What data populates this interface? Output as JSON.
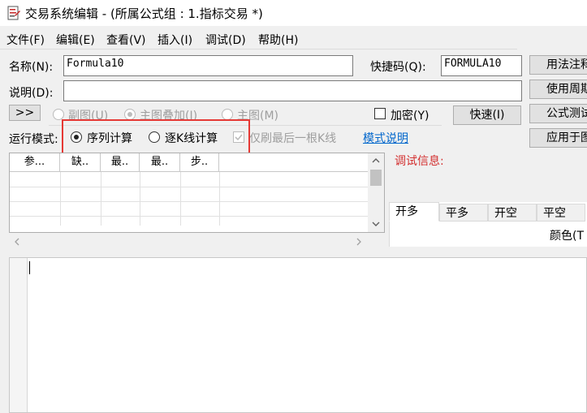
{
  "window": {
    "title": "交易系统编辑 - (所属公式组 : 1.指标交易 *)",
    "highlight_color": "#e53935"
  },
  "menu": {
    "items": [
      "文件(F)",
      "编辑(E)",
      "查看(V)",
      "插入(I)",
      "调试(D)",
      "帮助(H)"
    ]
  },
  "form": {
    "name_label": "名称(N):",
    "name_value": "Formula10",
    "shortcut_label": "快捷码(Q):",
    "shortcut_value": "FORMULA10",
    "desc_label": "说明(D):",
    "desc_value": ""
  },
  "right_buttons": [
    "用法注释",
    "使用周期",
    "公式测试",
    "应用于图"
  ],
  "options_row": {
    "expand_label": ">>",
    "sub_chart": "副图(U)",
    "main_overlay": "主图叠加(I)",
    "main_chart": "主图(M)",
    "encrypt": "加密(Y)",
    "quick_button": "快速(I)"
  },
  "mode_row": {
    "label": "运行模式:",
    "sequence": "序列计算",
    "bar_by_bar": "逐K线计算",
    "last_bar_only": "仅刷最后一根K线",
    "mode_help": "模式说明",
    "selected": "序列计算"
  },
  "params_table": {
    "columns": [
      "参...",
      "缺..",
      "最..",
      "最..",
      "步.."
    ]
  },
  "debug": {
    "label": "调试信息:",
    "label_color": "#d32f2f"
  },
  "trade_tabs": {
    "tabs": [
      "开多",
      "平多",
      "开空",
      "平空"
    ],
    "active": "开多",
    "color_label": "颜色(T"
  },
  "icons": [
    "app-icon",
    "radio-icon",
    "checkbox-icon",
    "scroll-up-icon",
    "scroll-down-icon",
    "scroll-left-icon",
    "scroll-right-icon"
  ]
}
